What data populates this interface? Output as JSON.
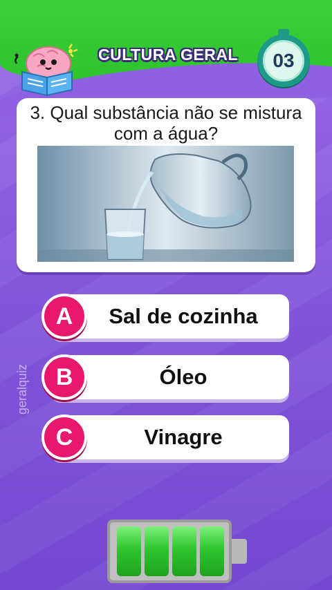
{
  "header": {
    "title": "CULTURA GERAL",
    "timer": "03"
  },
  "question": {
    "text": "3. Qual substância não se mistura com a água?"
  },
  "answers": [
    {
      "letter": "A",
      "label": "Sal de cozinha"
    },
    {
      "letter": "B",
      "label": "Óleo"
    },
    {
      "letter": "C",
      "label": "Vinagre"
    }
  ],
  "watermark": "geralquiz",
  "battery": {
    "cells_filled": 4,
    "cells_total": 4
  },
  "colors": {
    "header_green": "#2bc12a",
    "background_purple": "#8256da",
    "badge_pink": "#e7186e",
    "timer_teal": "#1f9a88",
    "battery_green": "#2fc52f"
  },
  "icons": {
    "mascot": "brain-reading-book-icon",
    "timer": "stopwatch-icon",
    "battery": "battery-icon",
    "photo": "water-pitcher-glass-photo"
  }
}
